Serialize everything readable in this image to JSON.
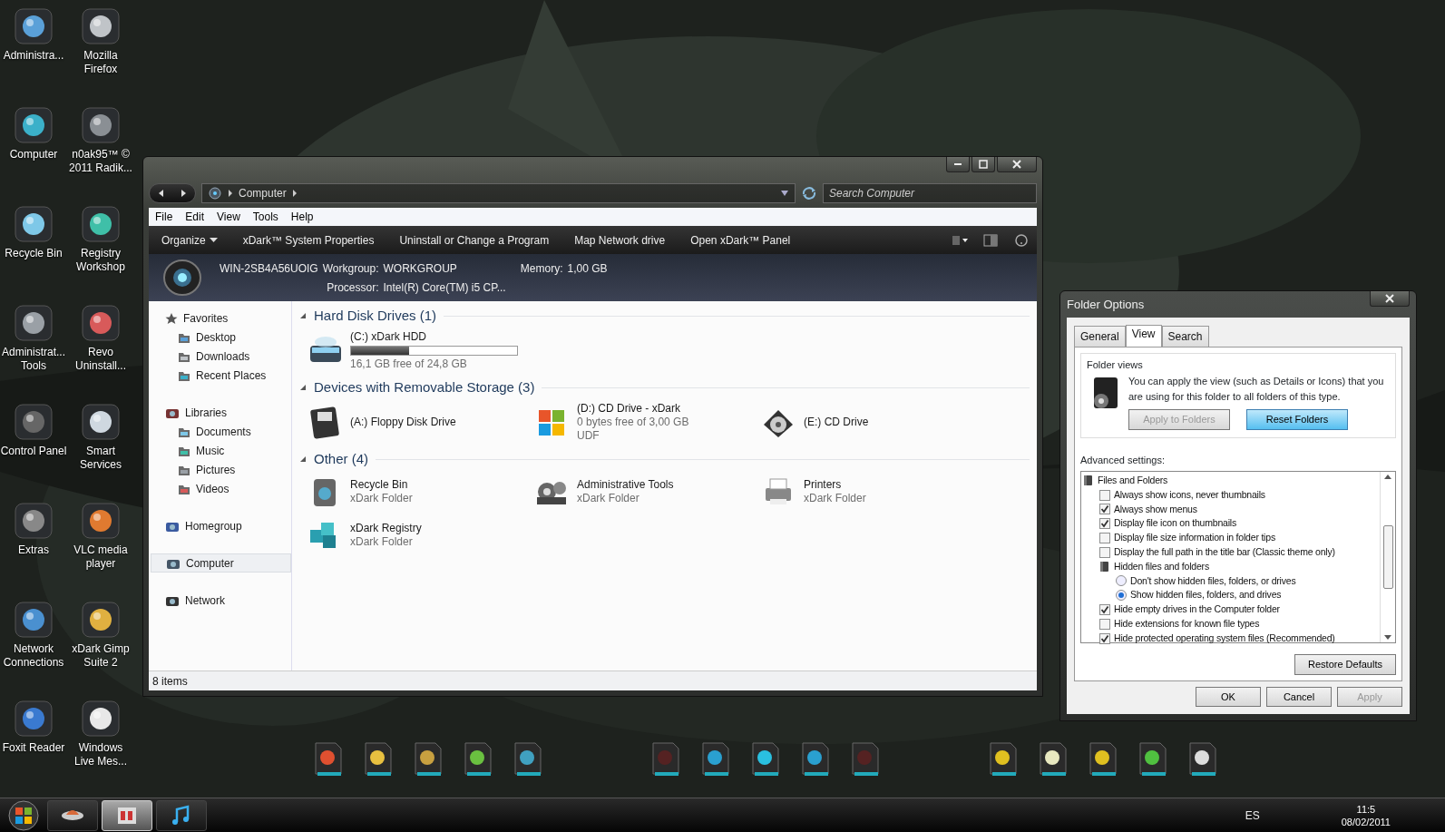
{
  "desktop_icons": [
    {
      "label": "Administra..."
    },
    {
      "label": "Mozilla Firefox"
    },
    {
      "label": "Computer"
    },
    {
      "label": "n0ak95™ © 2011 Radik..."
    },
    {
      "label": "Recycle Bin"
    },
    {
      "label": "Registry Workshop"
    },
    {
      "label": "Administrat... Tools"
    },
    {
      "label": "Revo Uninstall..."
    },
    {
      "label": "Control Panel"
    },
    {
      "label": "Smart Services"
    },
    {
      "label": "Extras"
    },
    {
      "label": "VLC media player"
    },
    {
      "label": "Network Connections"
    },
    {
      "label": "xDark Gimp Suite 2"
    },
    {
      "label": "Foxit Reader"
    },
    {
      "label": "Windows Live Mes..."
    }
  ],
  "explorer": {
    "breadcrumb": [
      "Computer"
    ],
    "search": {
      "placeholder": "Search Computer"
    },
    "menu": [
      "File",
      "Edit",
      "View",
      "Tools",
      "Help"
    ],
    "commands": [
      {
        "label": "Organize",
        "dropdown": true
      },
      {
        "label": "xDark™ System Properties",
        "dropdown": false
      },
      {
        "label": "Uninstall or Change a Program",
        "dropdown": false
      },
      {
        "label": "Map Network drive",
        "dropdown": false
      },
      {
        "label": "Open xDark™ Panel",
        "dropdown": false
      }
    ],
    "details": {
      "computer_name": "WIN-2SB4A56UOIG",
      "fields": [
        {
          "label": "Workgroup:",
          "value": "WORKGROUP"
        },
        {
          "label": "Memory:",
          "value": "1,00 GB"
        },
        {
          "label": "Processor:",
          "value": "Intel(R) Core(TM) i5 CP..."
        }
      ]
    },
    "nav": [
      {
        "label": "Favorites",
        "selected": false,
        "children": [
          {
            "label": "Desktop",
            "selected": false
          },
          {
            "label": "Downloads",
            "selected": false
          },
          {
            "label": "Recent Places",
            "selected": false
          }
        ]
      },
      {
        "label": "Libraries",
        "selected": false,
        "children": [
          {
            "label": "Documents",
            "selected": false
          },
          {
            "label": "Music",
            "selected": false
          },
          {
            "label": "Pictures",
            "selected": false
          },
          {
            "label": "Videos",
            "selected": false
          }
        ]
      },
      {
        "label": "Homegroup",
        "selected": false
      },
      {
        "label": "Computer",
        "selected": true
      },
      {
        "label": "Network",
        "selected": false
      }
    ],
    "groups": [
      {
        "title": "Hard Disk Drives (1)",
        "expanded": true,
        "items": [
          {
            "kind": "drive",
            "name": "(C:) xDark HDD",
            "level": 0.35,
            "lines": [
              "16,1 GB free of 24,8 GB"
            ]
          }
        ]
      },
      {
        "title": "Devices with Removable Storage (3)",
        "expanded": true,
        "items": [
          {
            "kind": "device",
            "name": "(A:) Floppy Disk Drive"
          },
          {
            "kind": "device",
            "name": "(D:) CD Drive - xDark",
            "lines": [
              "0 bytes free of 3,00 GB",
              "UDF"
            ]
          },
          {
            "kind": "device",
            "name": "(E:) CD Drive"
          }
        ]
      },
      {
        "title": "Other (4)",
        "expanded": true,
        "items": [
          {
            "kind": "device",
            "name": "Recycle Bin",
            "lines": [
              "xDark Folder"
            ]
          },
          {
            "kind": "device",
            "name": "Administrative Tools",
            "lines": [
              "xDark Folder"
            ]
          },
          {
            "kind": "device",
            "name": "Printers",
            "lines": [
              "xDark Folder"
            ]
          },
          {
            "kind": "device",
            "name": "xDark Registry",
            "lines": [
              "xDark Folder"
            ]
          }
        ]
      }
    ],
    "status_bar": "8 items"
  },
  "folder_options": {
    "title": "Folder Options",
    "tabs": [
      {
        "label": "General",
        "selected": false
      },
      {
        "label": "View",
        "selected": true
      },
      {
        "label": "Search",
        "selected": false
      }
    ],
    "folder_views": {
      "heading": "Folder views",
      "text": "You can apply the view (such as Details or Icons) that you are using for this folder to all folders of this type.",
      "buttons": [
        {
          "label": "Apply to Folders",
          "disabled": true,
          "hot": false
        },
        {
          "label": "Reset Folders",
          "disabled": false,
          "hot": true
        }
      ]
    },
    "advanced_label": "Advanced settings:",
    "settings": [
      {
        "kind": "folder",
        "label": "Files and Folders",
        "children": [
          {
            "kind": "checkbox",
            "label": "Always show icons, never thumbnails",
            "checked": false
          },
          {
            "kind": "checkbox",
            "label": "Always show menus",
            "checked": true
          },
          {
            "kind": "checkbox",
            "label": "Display file icon on thumbnails",
            "checked": true
          },
          {
            "kind": "checkbox",
            "label": "Display file size information in folder tips",
            "checked": false
          },
          {
            "kind": "checkbox",
            "label": "Display the full path in the title bar (Classic theme only)",
            "checked": false
          },
          {
            "kind": "folder",
            "label": "Hidden files and folders",
            "children": [
              {
                "kind": "radio",
                "label": "Don't show hidden files, folders, or drives",
                "checked": false
              },
              {
                "kind": "radio",
                "label": "Show hidden files, folders, and drives",
                "checked": true
              }
            ]
          },
          {
            "kind": "checkbox",
            "label": "Hide empty drives in the Computer folder",
            "checked": true
          },
          {
            "kind": "checkbox",
            "label": "Hide extensions for known file types",
            "checked": false
          },
          {
            "kind": "checkbox",
            "label": "Hide protected operating system files (Recommended)",
            "checked": true
          }
        ]
      }
    ],
    "restore": "Restore Defaults",
    "buttons": [
      {
        "label": "OK",
        "disabled": false
      },
      {
        "label": "Cancel",
        "disabled": false
      },
      {
        "label": "Apply",
        "disabled": true
      }
    ]
  },
  "taskbar": {
    "items": [
      {
        "selected": false
      },
      {
        "selected": true
      },
      {
        "selected": false
      }
    ],
    "language": "ES",
    "time": "11:5",
    "date": "08/02/2011"
  }
}
